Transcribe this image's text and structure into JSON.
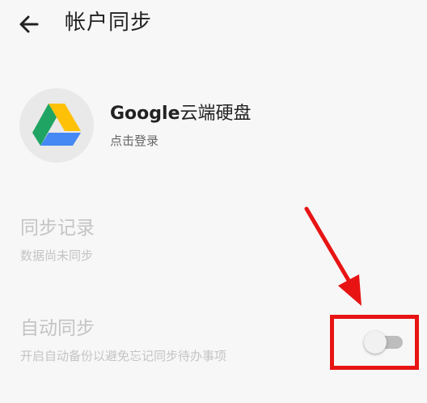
{
  "header": {
    "back_icon": "arrow-left-icon",
    "title": "帐户同步"
  },
  "account": {
    "name_latin": "Google",
    "name_cn": "云端硬盘",
    "subtitle": "点击登录",
    "icon": "google-drive-icon"
  },
  "sync_record": {
    "title": "同步记录",
    "subtitle": "数据尚未同步"
  },
  "auto_sync": {
    "title": "自动同步",
    "subtitle": "开启自动备份以避免忘记同步待办事项",
    "enabled": false
  },
  "colors": {
    "annotation": "#e81414",
    "drive_green": "#1fa463",
    "drive_yellow": "#ffd04b",
    "drive_blue": "#4688f4"
  }
}
